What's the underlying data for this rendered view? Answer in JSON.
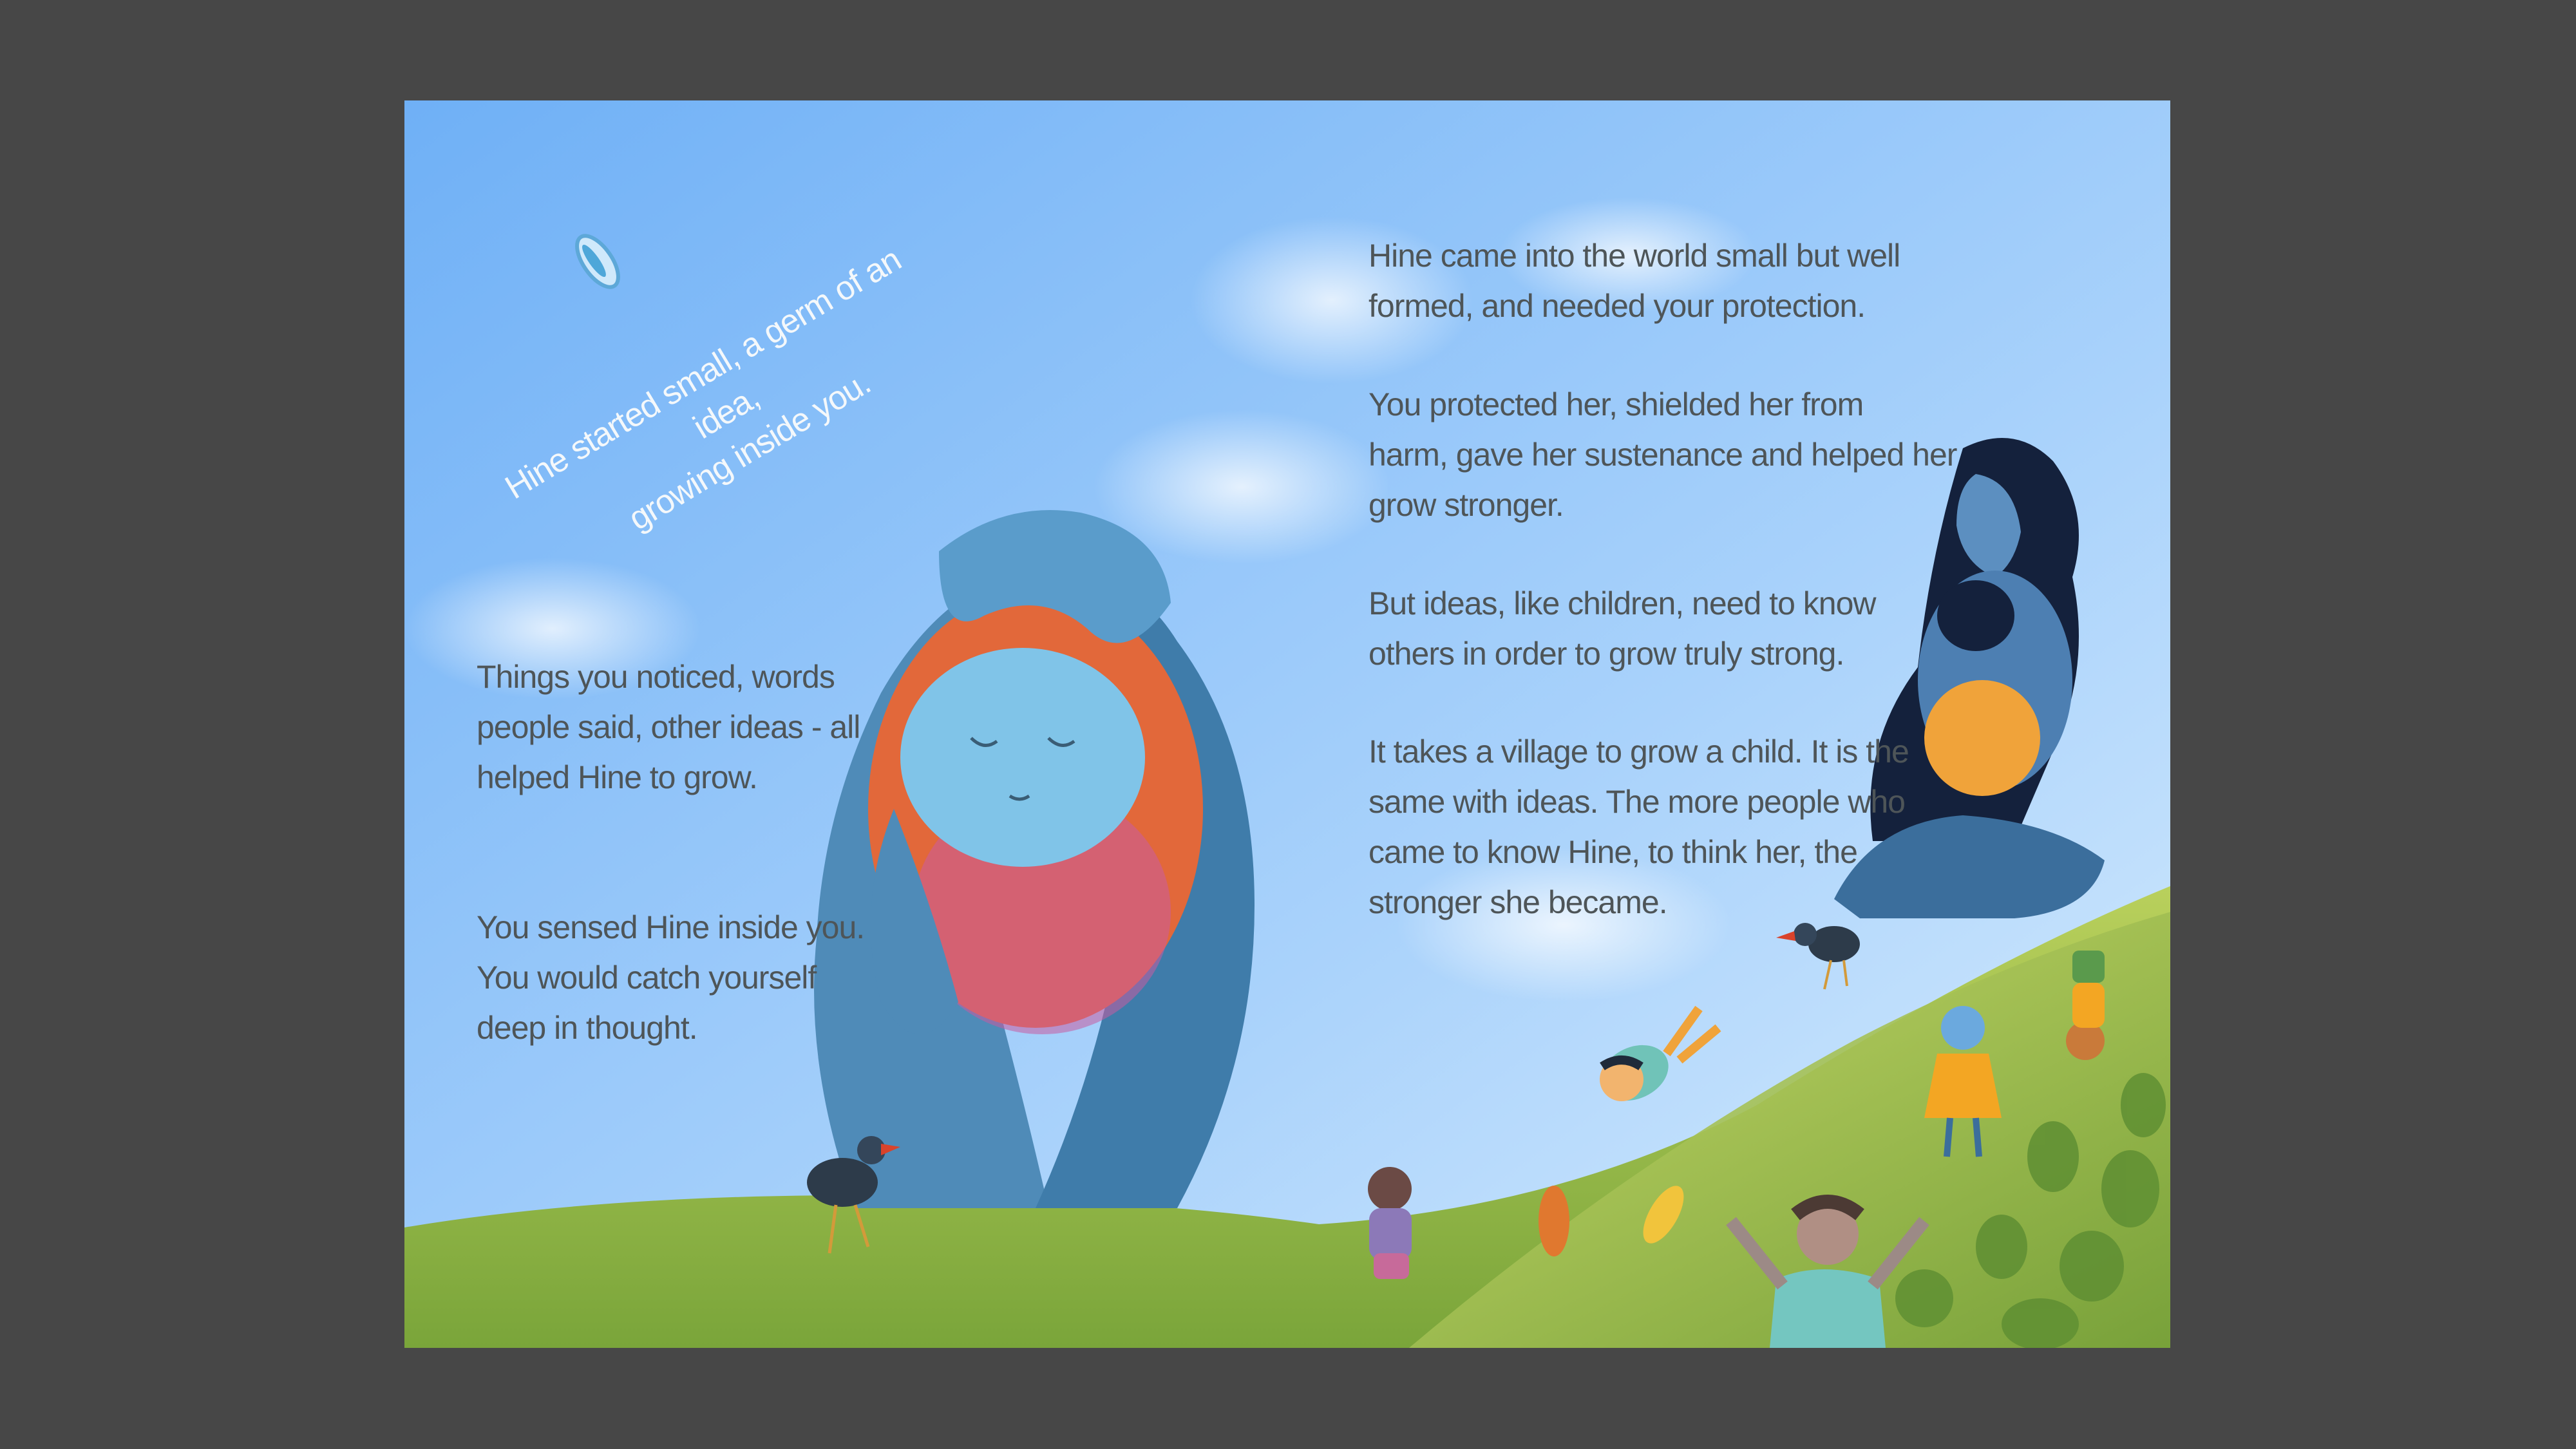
{
  "book": {
    "left_page": {
      "curved_caption": "Hine started small, a germ of an idea,\ngrowing inside you.",
      "paragraphs": [
        "Things you noticed, words\npeople said, other ideas - all\nhelped Hine to grow.",
        "You sensed Hine inside you.\nYou would catch yourself\ndeep in thought."
      ]
    },
    "right_page": {
      "paragraphs": [
        "Hine came into the world small but well\nformed, and needed your protection.",
        "You protected her, shielded her from\nharm, gave her sustenance and helped her\ngrow stronger.",
        "But ideas, like children, need to know\nothers in order to grow truly strong.",
        "It takes a village to grow a child. It is the\nsame with ideas. The more people who\ncame to know Hine, to think her, the\nstronger she became."
      ]
    }
  },
  "colors": {
    "backdrop": "#474747",
    "sky_top": "#6fb0f6",
    "sky_bottom": "#d7ecfd",
    "grass": "#8fb545",
    "text": "#4e5558",
    "caption_text": "#f4f8fb",
    "hands": "#4f8bb8",
    "blanket": "#e2683a"
  }
}
